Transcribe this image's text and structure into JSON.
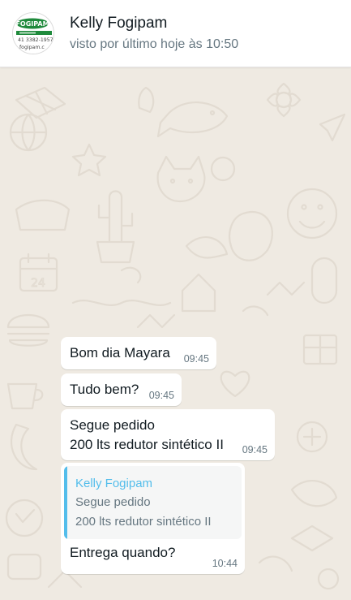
{
  "header": {
    "contact_name": "Kelly Fogipam",
    "status": "visto por último hoje às 10:50",
    "avatar": {
      "logo_text": "FOGIPAM",
      "phone": "41 3382-1957",
      "site": "fogipam.c"
    }
  },
  "messages": [
    {
      "text": [
        "Bom dia Mayara"
      ],
      "time": "09:45"
    },
    {
      "text": [
        "Tudo bem?"
      ],
      "time": "09:45"
    },
    {
      "text": [
        "Segue pedido",
        "200 lts redutor sintético II"
      ],
      "time": "09:45"
    },
    {
      "quoted": {
        "author": "Kelly Fogipam",
        "text": [
          "Segue pedido",
          "200 lts redutor sintético II"
        ]
      },
      "text": [
        "Entrega quando?"
      ],
      "time": "10:44"
    }
  ],
  "colors": {
    "chat_background": "#efeae2",
    "bubble": "#ffffff",
    "quote_accent": "#53bdeb",
    "meta_text": "#667781",
    "brand_green": "#1f8a3c"
  }
}
